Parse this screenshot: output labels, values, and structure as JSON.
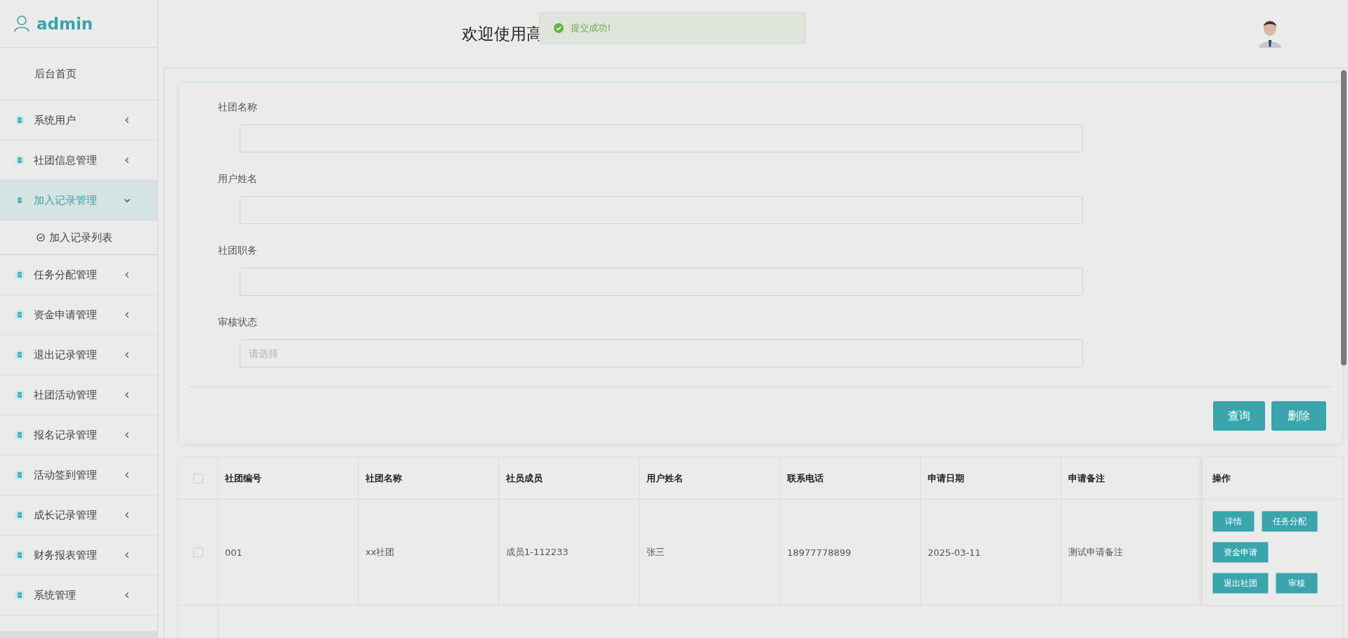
{
  "sidebar": {
    "user": "admin",
    "items": [
      {
        "kind": "link",
        "label": "后台首页",
        "selected": false
      },
      {
        "kind": "menu",
        "label": "系统用户",
        "selected": false,
        "expanded": false
      },
      {
        "kind": "menu",
        "label": "社团信息管理",
        "selected": false,
        "expanded": false
      },
      {
        "kind": "menu",
        "label": "加入记录管理",
        "selected": true,
        "expanded": true,
        "children": [
          {
            "label": "加入记录列表"
          }
        ]
      },
      {
        "kind": "menu",
        "label": "任务分配管理",
        "selected": false,
        "expanded": false
      },
      {
        "kind": "menu",
        "label": "资金申请管理",
        "selected": false,
        "expanded": false
      },
      {
        "kind": "menu",
        "label": "退出记录管理",
        "selected": false,
        "expanded": false
      },
      {
        "kind": "menu",
        "label": "社团活动管理",
        "selected": false,
        "expanded": false
      },
      {
        "kind": "menu",
        "label": "报名记录管理",
        "selected": false,
        "expanded": false
      },
      {
        "kind": "menu",
        "label": "活动签到管理",
        "selected": false,
        "expanded": false
      },
      {
        "kind": "menu",
        "label": "成长记录管理",
        "selected": false,
        "expanded": false
      },
      {
        "kind": "menu",
        "label": "财务报表管理",
        "selected": false,
        "expanded": false
      },
      {
        "kind": "menu",
        "label": "系统管理",
        "selected": false,
        "expanded": false
      }
    ]
  },
  "header": {
    "title": "欢迎使用高",
    "toast": {
      "kind": "success",
      "text": "提交成功!"
    }
  },
  "form": {
    "fields": [
      {
        "label": "社团名称",
        "kind": "input"
      },
      {
        "label": "用户姓名",
        "kind": "input"
      },
      {
        "label": "社团职务",
        "kind": "input"
      },
      {
        "label": "审核状态",
        "kind": "select",
        "placeholder": "请选择"
      }
    ],
    "buttons": [
      "查询",
      "删除"
    ]
  },
  "table": {
    "select_all": {
      "checked": false
    },
    "columns": [
      "社团编号",
      "社团名称",
      "社员成员",
      "用户姓名",
      "联系电话",
      "申请日期",
      "申请备注",
      "操作"
    ],
    "rows": [
      {
        "checked": false,
        "cells": [
          "001",
          "xx社团",
          "成员1-112233",
          "张三",
          "18977778899",
          "2025-03-11",
          "测试申请备注"
        ],
        "actions": [
          "详情",
          "任务分配",
          "资金申请",
          "退出社团",
          "审核"
        ]
      }
    ]
  }
}
